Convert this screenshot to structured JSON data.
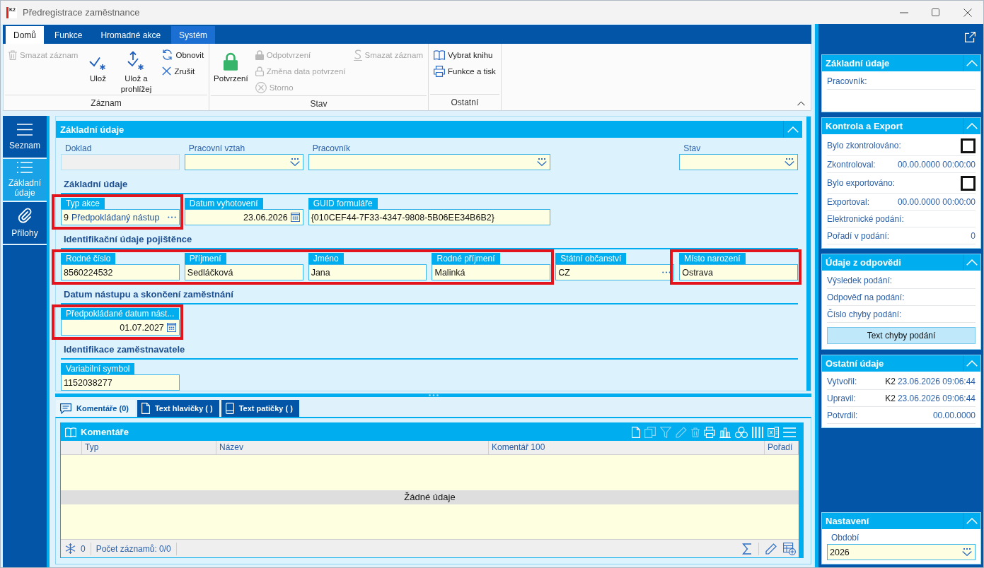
{
  "window": {
    "logo": "K2",
    "title": "Předregistrace zaměstnance"
  },
  "ribbon": {
    "tabs": [
      {
        "label": "Domů",
        "selected": true,
        "highlighted": false
      },
      {
        "label": "Funkce",
        "selected": false,
        "highlighted": false
      },
      {
        "label": "Hromadné akce",
        "selected": false,
        "highlighted": false
      },
      {
        "label": "Systém",
        "selected": false,
        "highlighted": true
      }
    ],
    "groups": [
      {
        "label": "Záznam",
        "columns": [
          [
            {
              "kind": "small",
              "label": "Smazat záznam",
              "disabled": true
            }
          ],
          [
            {
              "kind": "large",
              "label": "Ulož",
              "disabled": false
            }
          ],
          [
            {
              "kind": "large",
              "label": "Ulož a prohlížej",
              "disabled": false
            }
          ],
          [
            {
              "kind": "small",
              "label": "Obnovit",
              "disabled": false
            },
            {
              "kind": "small",
              "label": "Zrušit",
              "disabled": false
            }
          ]
        ]
      },
      {
        "label": "Stav",
        "columns": [
          [
            {
              "kind": "large",
              "label": "Potvrzení",
              "disabled": false
            }
          ],
          [
            {
              "kind": "small",
              "label": "Odpotvrzení",
              "disabled": true
            },
            {
              "kind": "small",
              "label": "Změna data potvrzení",
              "disabled": true
            },
            {
              "kind": "small",
              "label": "Storno",
              "disabled": true
            }
          ],
          [
            {
              "kind": "small",
              "label": "Smazat záznam",
              "disabled": true
            }
          ]
        ]
      },
      {
        "label": "Ostatní",
        "columns": [
          [
            {
              "kind": "small",
              "label": "Vybrat knihu",
              "disabled": false
            },
            {
              "kind": "small",
              "label": "Funkce a tisk",
              "disabled": false
            }
          ]
        ]
      }
    ]
  },
  "nav": [
    {
      "label": "Seznam",
      "selected": false
    },
    {
      "label": "Základní údaje",
      "selected": true
    },
    {
      "label": "Přílohy",
      "selected": false
    }
  ],
  "form": {
    "title": "Základní údaje",
    "top_fields": [
      {
        "label": "Doklad",
        "kind": "text",
        "disabled": true
      },
      {
        "label": "Pracovní vztah",
        "kind": "dropdown",
        "disabled": false
      },
      {
        "label": "Pracovník",
        "kind": "dropdown",
        "disabled": false
      },
      {
        "label": "Stav",
        "kind": "dropdown",
        "disabled": false
      }
    ],
    "sections": [
      {
        "title": "Základní údaje",
        "fields": [
          {
            "label": "Typ akce",
            "kind": "lookup",
            "code": "9",
            "value": "Předpokládaný nástup",
            "highlighted": true
          },
          {
            "label": "Datum vyhotovení",
            "kind": "date",
            "value": "23.06.2026",
            "highlighted": false
          },
          {
            "label": "GUID formuláře",
            "kind": "text",
            "value": "{010CEF44-7F33-4347-9808-5B06EE34B6B2}",
            "highlighted": false
          }
        ]
      },
      {
        "title": "Identifikační údaje pojištěnce",
        "fields": [
          {
            "label": "Rodné číslo",
            "kind": "text",
            "value": "8560224532",
            "highlighted": true
          },
          {
            "label": "Příjmení",
            "kind": "text",
            "value": "Sedláčková",
            "highlighted": true
          },
          {
            "label": "Jméno",
            "kind": "text",
            "value": "Jana",
            "highlighted": true
          },
          {
            "label": "Rodné příjmení",
            "kind": "text",
            "value": "Malinká",
            "highlighted": true
          },
          {
            "label": "Státní občanství",
            "kind": "lookup",
            "value": "CZ",
            "highlighted": false
          },
          {
            "label": "Místo narození",
            "kind": "text",
            "value": "Ostrava",
            "highlighted": true
          }
        ]
      },
      {
        "title": "Datum nástupu a skončení zaměstnání",
        "fields": [
          {
            "label": "Předpokládané datum nást...",
            "kind": "date",
            "value": "01.07.2027",
            "highlighted": true
          }
        ]
      },
      {
        "title": "Identifikace zaměstnavatele",
        "fields": [
          {
            "label": "Variabilní symbol",
            "kind": "text",
            "value": "1152038277",
            "highlighted": false
          }
        ]
      }
    ]
  },
  "detail_tabs": [
    {
      "label": "Komentáře (0)",
      "selected": true
    },
    {
      "label": "Text hlavičky ( )",
      "selected": false
    },
    {
      "label": "Text patičky ( )",
      "selected": false
    }
  ],
  "grid": {
    "title": "Komentáře",
    "toolbar": [
      {
        "disabled": false
      },
      {
        "disabled": true
      },
      {
        "disabled": true
      },
      {
        "disabled": true
      },
      {
        "disabled": true
      },
      {
        "disabled": false
      },
      {
        "disabled": false
      },
      {
        "disabled": false
      },
      {
        "disabled": false
      },
      {
        "disabled": false
      },
      {
        "disabled": false
      }
    ],
    "columns": [
      "Typ",
      "Název",
      "Komentář 100",
      "Pořadí"
    ],
    "empty_text": "Žádné údaje",
    "footer": {
      "count": "0",
      "records": "Počet záznamů: 0/0"
    }
  },
  "side_panels": [
    {
      "title": "Základní údaje",
      "rows": [
        {
          "kind": "text",
          "label": "Pracovník:"
        }
      ]
    },
    {
      "title": "Kontrola a Export",
      "rows": [
        {
          "kind": "check",
          "label": "Bylo zkontrolováno:",
          "checked": false
        },
        {
          "kind": "text",
          "label": "Zkontroloval:",
          "value": "00.00.0000 00:00:00"
        },
        {
          "kind": "check",
          "label": "Bylo exportováno:",
          "checked": false
        },
        {
          "kind": "text",
          "label": "Exportoval:",
          "value": "00.00.0000 00:00:00"
        },
        {
          "kind": "text",
          "label": "Elektronické podání:"
        },
        {
          "kind": "text",
          "label": "Pořadí v podání:",
          "value": "0"
        }
      ]
    },
    {
      "title": "Údaje z odpovědi",
      "rows": [
        {
          "kind": "text",
          "label": "Výsledek podání:"
        },
        {
          "kind": "text",
          "label": "Odpověď na podání:"
        },
        {
          "kind": "text",
          "label": "Číslo chyby podání:"
        },
        {
          "kind": "button",
          "label": "Text chyby podání"
        }
      ]
    },
    {
      "title": "Ostatní údaje",
      "rows": [
        {
          "kind": "text",
          "label": "Vytvořil:",
          "user": "K2",
          "value": "23.06.2026 09:06:44"
        },
        {
          "kind": "text",
          "label": "Upravil:",
          "user": "K2",
          "value": "23.06.2026 09:06:44"
        },
        {
          "kind": "text",
          "label": "Potvrdil:",
          "value": "00.00.0000"
        }
      ]
    }
  ],
  "settings": {
    "title": "Nastavení",
    "label": "Období",
    "value": "2026"
  }
}
